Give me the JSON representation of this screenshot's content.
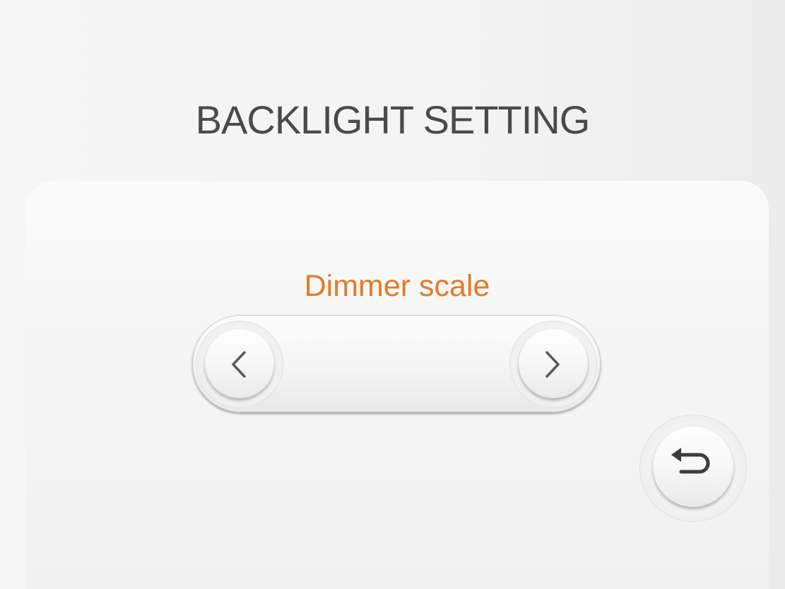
{
  "header": {
    "title": "BACKLIGHT SETTING"
  },
  "setting": {
    "label": "Dimmer scale",
    "label_color": "#e47a26",
    "value": ""
  },
  "controls": {
    "decrease_icon": "chevron-left-icon",
    "increase_icon": "chevron-right-icon",
    "back_icon": "return-arrow-icon"
  },
  "colors": {
    "title": "#4a4a4a",
    "accent": "#e47a26",
    "icon": "#5a5a5a"
  }
}
